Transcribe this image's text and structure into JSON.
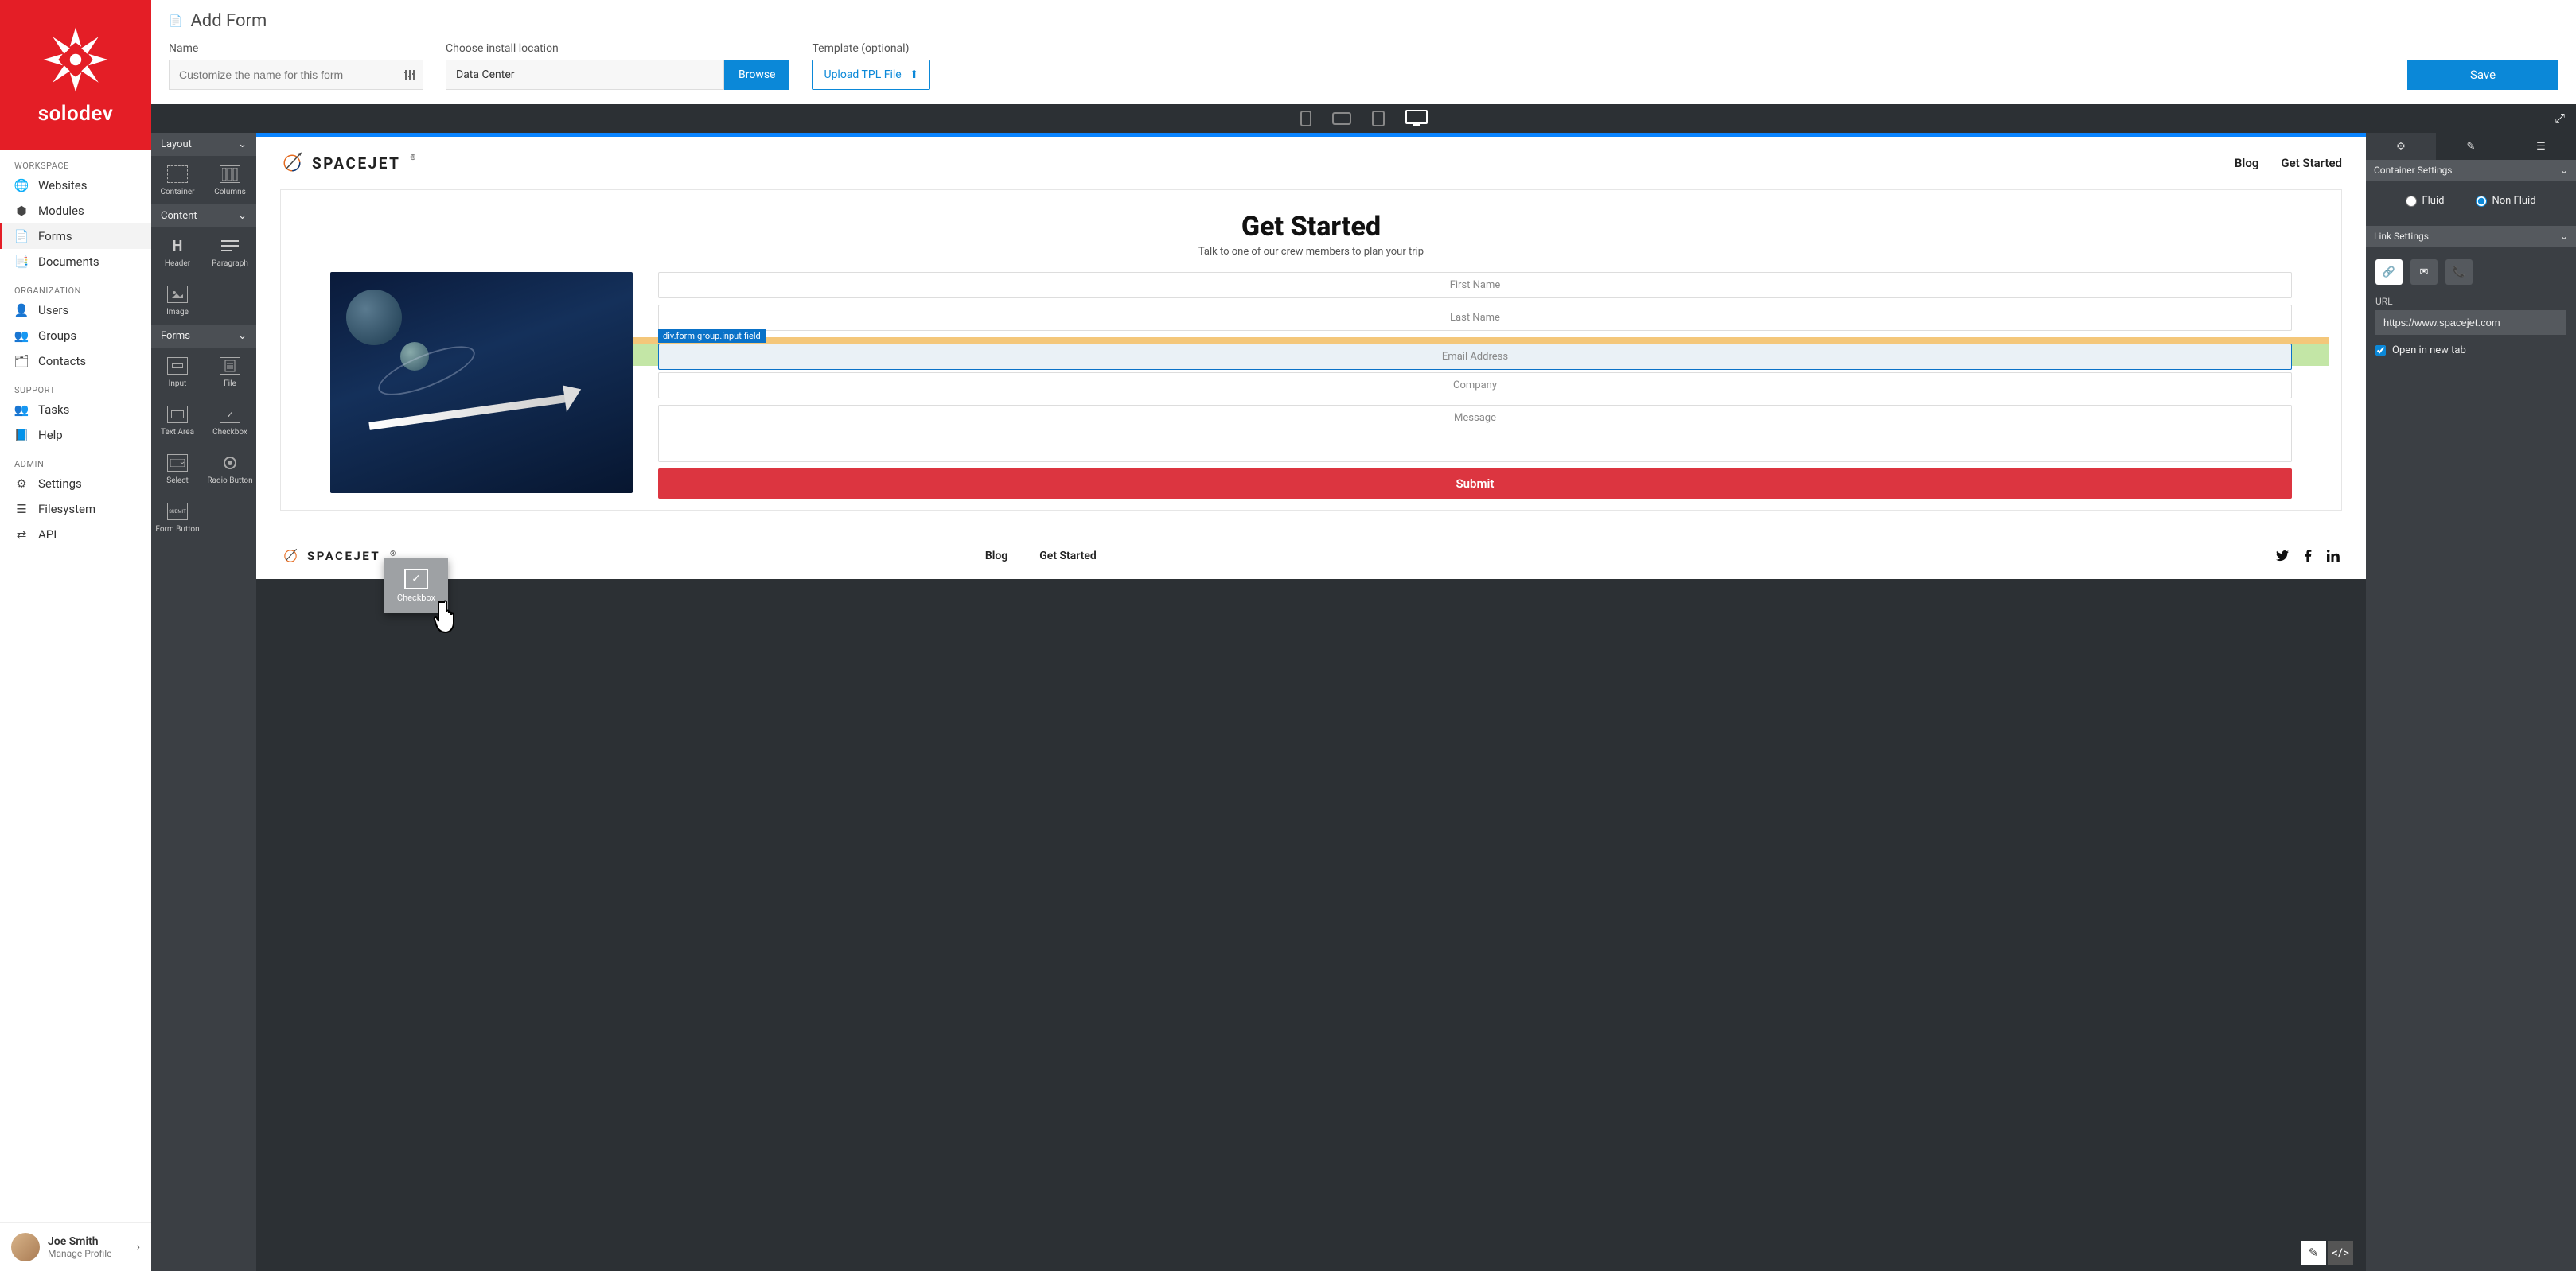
{
  "brand": {
    "name": "solodev"
  },
  "page": {
    "title": "Add Form"
  },
  "fields": {
    "name_label": "Name",
    "name_placeholder": "Customize the name for this form",
    "location_label": "Choose install location",
    "location_value": "Data Center",
    "browse": "Browse",
    "template_label": "Template (optional)",
    "upload_btn": "Upload TPL File",
    "save": "Save"
  },
  "sidebar": {
    "sections": {
      "workspace": "WORKSPACE",
      "organization": "ORGANIZATION",
      "support": "SUPPORT",
      "admin": "ADMIN"
    },
    "workspace": [
      "Websites",
      "Modules",
      "Forms",
      "Documents"
    ],
    "organization": [
      "Users",
      "Groups",
      "Contacts"
    ],
    "support": [
      "Tasks",
      "Help"
    ],
    "admin": [
      "Settings",
      "Filesystem",
      "API"
    ]
  },
  "user": {
    "name": "Joe Smith",
    "sub": "Manage Profile"
  },
  "palette": {
    "sections": {
      "layout": "Layout",
      "content": "Content",
      "forms": "Forms"
    },
    "layout": [
      "Container",
      "Columns"
    ],
    "content": [
      "Header",
      "Paragraph",
      "Image"
    ],
    "forms": [
      "Input",
      "File",
      "Text Area",
      "Checkbox",
      "Select",
      "Radio Button",
      "Form Button"
    ]
  },
  "drag": {
    "label": "Checkbox"
  },
  "site": {
    "brand": "SPACEJET",
    "nav": [
      "Blog",
      "Get Started"
    ],
    "hero_title": "Get Started",
    "hero_sub": "Talk to one of our crew members to plan your trip",
    "form_fields": {
      "first": "First Name",
      "last": "Last Name",
      "selection_tag": "div.form-group.input-field",
      "email": "Email Address",
      "company": "Company",
      "message": "Message",
      "submit": "Submit"
    },
    "footer_nav": [
      "Blog",
      "Get Started"
    ]
  },
  "settings": {
    "container_head": "Container Settings",
    "fluid": "Fluid",
    "nonfluid": "Non Fluid",
    "link_head": "Link Settings",
    "url_label": "URL",
    "url": "https://www.spacejet.com",
    "newtab": "Open in new tab"
  }
}
